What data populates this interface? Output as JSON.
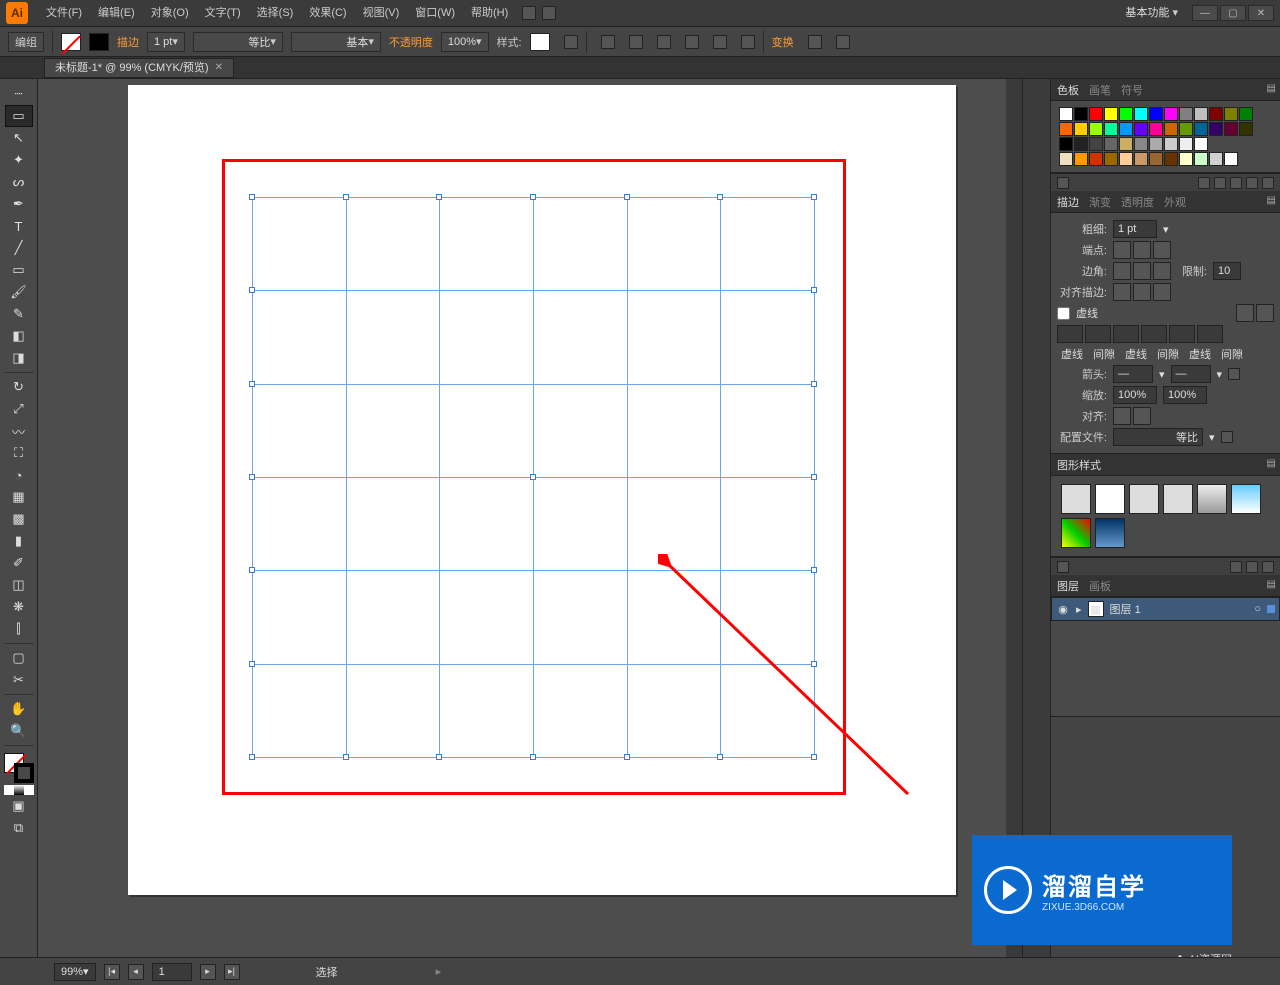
{
  "app": {
    "name": "Ai",
    "workspace": "基本功能"
  },
  "menu": [
    "文件(F)",
    "编辑(E)",
    "对象(O)",
    "文字(T)",
    "选择(S)",
    "效果(C)",
    "视图(V)",
    "窗口(W)",
    "帮助(H)"
  ],
  "control": {
    "edit_group": "编组",
    "stroke_label": "描边",
    "stroke_weight": "1 pt",
    "stroke_profile": "等比",
    "brush_def": "基本",
    "opacity_label": "不透明度",
    "opacity_value": "100%",
    "style_label": "样式:",
    "transform_label": "变换"
  },
  "doc_tab": {
    "title": "未标题-1* @ 99% (CMYK/预览)"
  },
  "tools": [
    "▭",
    "↖",
    "✦",
    "✒",
    "🖊",
    "⁄",
    "T",
    "╱",
    "▭",
    "🖌",
    "✎",
    "◧",
    "✂",
    "↻",
    "⤡",
    "✥",
    "〰",
    "▮",
    "⫿",
    "⫾",
    "▦",
    "▭",
    "✜",
    "◫",
    "✎",
    "✋",
    "🔍"
  ],
  "panels": {
    "swatches": {
      "tabs": [
        "色板",
        "画笔",
        "符号"
      ]
    },
    "stroke": {
      "tabs": [
        "描边",
        "渐变",
        "透明度",
        "外观"
      ],
      "weight_label": "粗细:",
      "weight": "1 pt",
      "cap_label": "端点:",
      "corner_label": "边角:",
      "limit_label": "限制:",
      "limit": "10",
      "align_label": "对齐描边:",
      "dash_label": "虚线",
      "dash_cols": [
        "虚线",
        "间隙",
        "虚线",
        "间隙",
        "虚线",
        "间隙"
      ],
      "arrow_label": "箭头:",
      "scale_label": "缩放:",
      "scale1": "100%",
      "scale2": "100%",
      "alignarrow_label": "对齐:",
      "profile_label": "配置文件:",
      "profile": "等比"
    },
    "gstyles": {
      "tabs": [
        "图形样式"
      ]
    },
    "layers": {
      "tabs": [
        "图层",
        "画板"
      ],
      "layer_name": "图层 1"
    }
  },
  "status": {
    "zoom": "99%",
    "page": "1",
    "tool": "选择"
  },
  "swatch_colors": [
    "#ffffff",
    "#000000",
    "#ff0000",
    "#ffff00",
    "#00ff00",
    "#00ffff",
    "#0000ff",
    "#ff00ff",
    "#808080",
    "#c0c0c0",
    "#800000",
    "#808000",
    "#008000",
    "#ff6600",
    "#ffcc00",
    "#99ff00",
    "#00ff99",
    "#0099ff",
    "#6600ff",
    "#ff0099",
    "#cc6600",
    "#669900",
    "#006699",
    "#330066",
    "#660033",
    "#333300",
    "#000000",
    "#222222",
    "#444444",
    "#666666",
    "#c8b060",
    "#888888",
    "#aaaaaa",
    "#cccccc",
    "#eeeeee",
    "#ffffff",
    "",
    "",
    "",
    "#f0e0c0",
    "#ff9900",
    "#cc3300",
    "#996600",
    "#ffcc99",
    "#cc9966",
    "#996633",
    "#663300",
    "#ffffcc",
    "#ccffcc",
    "#d0d0d0",
    "#ffffff",
    ""
  ],
  "watermark": {
    "big": "溜溜自学",
    "small": "ZIXUE.3D66.COM",
    "sub": "AI资源网"
  }
}
